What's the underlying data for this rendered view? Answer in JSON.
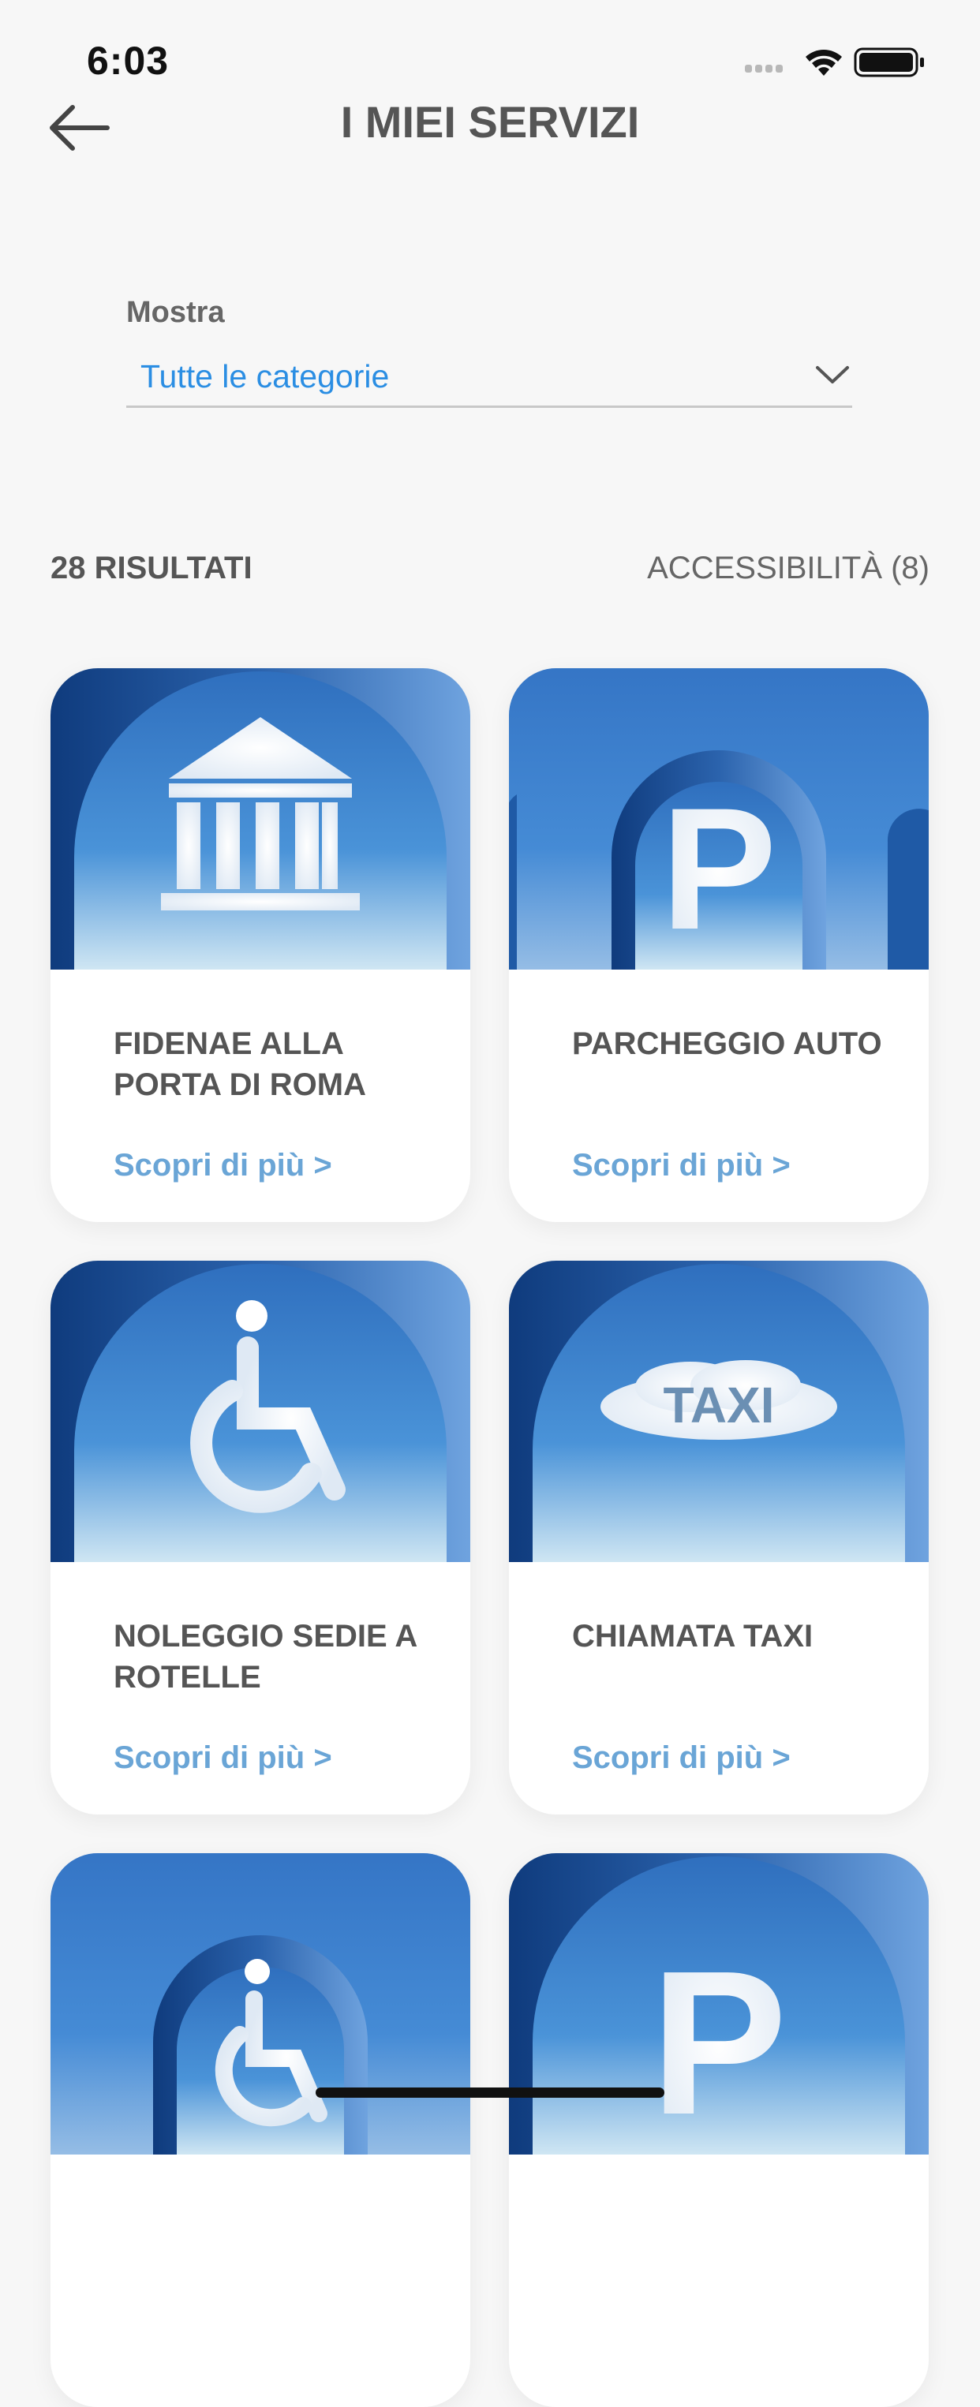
{
  "status": {
    "time": "6:03"
  },
  "header": {
    "title": "I MIEI SERVIZI",
    "back_icon": "arrow-left-icon"
  },
  "filter": {
    "label": "Mostra",
    "selected": "Tutte le categorie"
  },
  "results": {
    "count_text": "28 RISULTATI",
    "accessibility": "ACCESSIBILITÀ (8)"
  },
  "cards": [
    {
      "title": "FIDENAE ALLA PORTA DI ROMA",
      "link": "Scopri di più >",
      "icon": "museum-icon"
    },
    {
      "title": "PARCHEGGIO AUTO",
      "link": "Scopri di più >",
      "icon": "parking-icon"
    },
    {
      "title": "NOLEGGIO SEDIE A ROTELLE",
      "link": "Scopri di più >",
      "icon": "wheelchair-icon"
    },
    {
      "title": "CHIAMATA TAXI",
      "link": "Scopri di più >",
      "icon": "taxi-icon"
    },
    {
      "title": "",
      "link": "",
      "icon": "wheelchair-icon"
    },
    {
      "title": "",
      "link": "",
      "icon": "parking-icon"
    }
  ],
  "colors": {
    "accent": "#2b8ee3",
    "link": "#6aa5d6",
    "sky": "#3f86cf"
  },
  "taxi_label": "TAXI"
}
